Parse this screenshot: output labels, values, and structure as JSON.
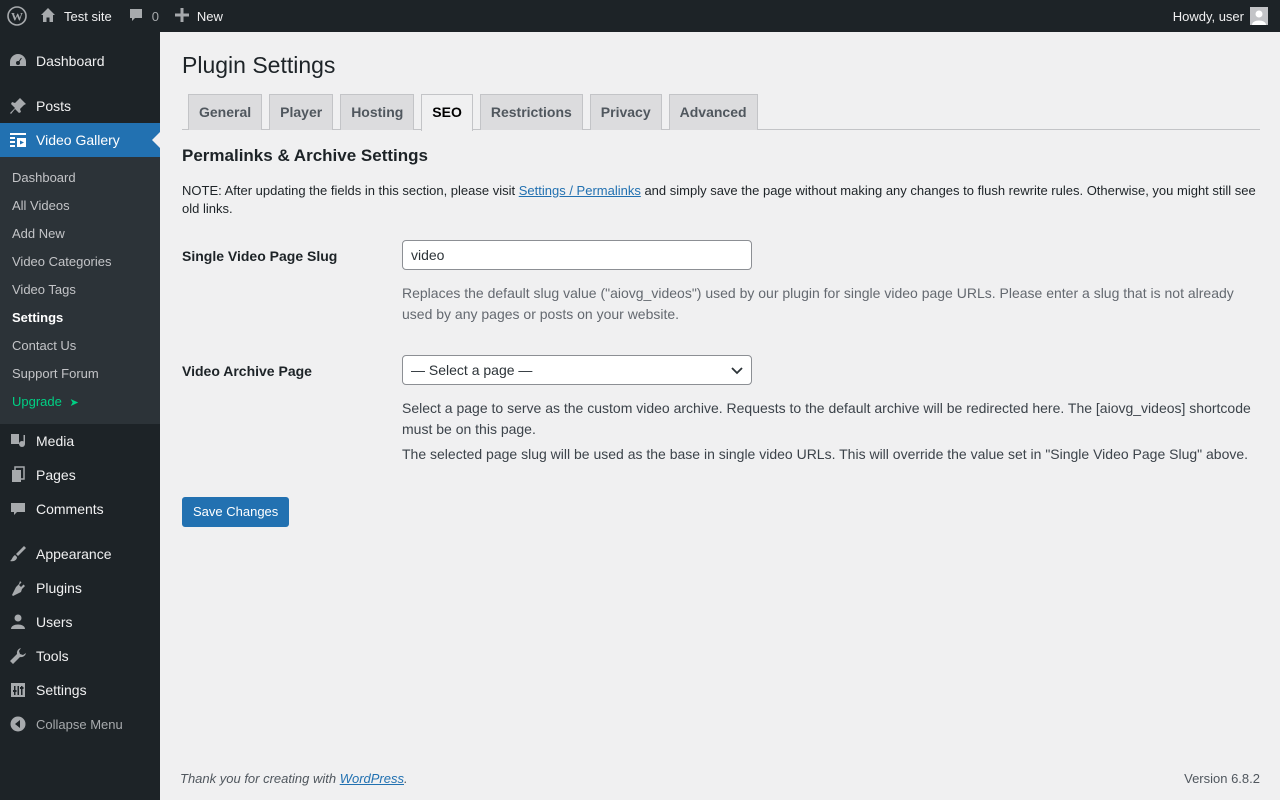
{
  "adminbar": {
    "site_name": "Test site",
    "comments_count": "0",
    "new_label": "New",
    "greeting": "Howdy, user",
    "icons": {
      "wp": "wordpress-logo-icon",
      "home": "home-icon",
      "comments": "comment-bubble-icon",
      "new": "plus-icon",
      "avatar": "user-avatar-icon"
    }
  },
  "sidebar": {
    "top_items": [
      {
        "label": "Dashboard",
        "icon": "dashboard-icon"
      },
      {
        "label": "Posts",
        "icon": "pushpin-icon"
      },
      {
        "label": "Video Gallery",
        "icon": "video-gallery-icon"
      }
    ],
    "submenu": [
      "Dashboard",
      "All Videos",
      "Add New",
      "Video Categories",
      "Video Tags",
      "Settings",
      "Contact Us",
      "Support Forum",
      "Upgrade"
    ],
    "upgrade_arrow": "➤",
    "bottom_items": [
      {
        "label": "Media",
        "icon": "media-icon"
      },
      {
        "label": "Pages",
        "icon": "pages-icon"
      },
      {
        "label": "Comments",
        "icon": "comments-icon"
      },
      {
        "label": "Appearance",
        "icon": "paintbrush-icon"
      },
      {
        "label": "Plugins",
        "icon": "plug-icon"
      },
      {
        "label": "Users",
        "icon": "user-icon"
      },
      {
        "label": "Tools",
        "icon": "wrench-icon"
      },
      {
        "label": "Settings",
        "icon": "settings-icon"
      }
    ],
    "collapse_label": "Collapse Menu",
    "accent_color": "#2271b1",
    "upgrade_color": "#00d084"
  },
  "main": {
    "title": "Plugin Settings",
    "tabs": [
      "General",
      "Player",
      "Hosting",
      "SEO",
      "Restrictions",
      "Privacy",
      "Advanced"
    ],
    "active_tab": "SEO",
    "section_title": "Permalinks & Archive Settings",
    "note_prefix": "NOTE: After updating the fields in this section, please visit ",
    "note_link": "Settings / Permalinks",
    "note_suffix": " and simply save the page without making any changes to flush rewrite rules. Otherwise, you might still see old links.",
    "slug": {
      "label": "Single Video Page Slug",
      "value": "video",
      "description": "Replaces the default slug value (\"aiovg_videos\") used by our plugin for single video page URLs. Please enter a slug that is not already used by any pages or posts on your website."
    },
    "archive": {
      "label": "Video Archive Page",
      "selected": "— Select a page —",
      "description1": "Select a page to serve as the custom video archive. Requests to the default archive will be redirected here. The [aiovg_videos] shortcode must be on this page.",
      "description2": "The selected page slug will be used as the base in single video URLs. This will override the value set in \"Single Video Page Slug\" above."
    },
    "save_label": "Save Changes"
  },
  "footer": {
    "thanks_prefix": "Thank you for creating with ",
    "thanks_link": "WordPress",
    "thanks_suffix": ".",
    "version": "Version 6.8.2"
  }
}
